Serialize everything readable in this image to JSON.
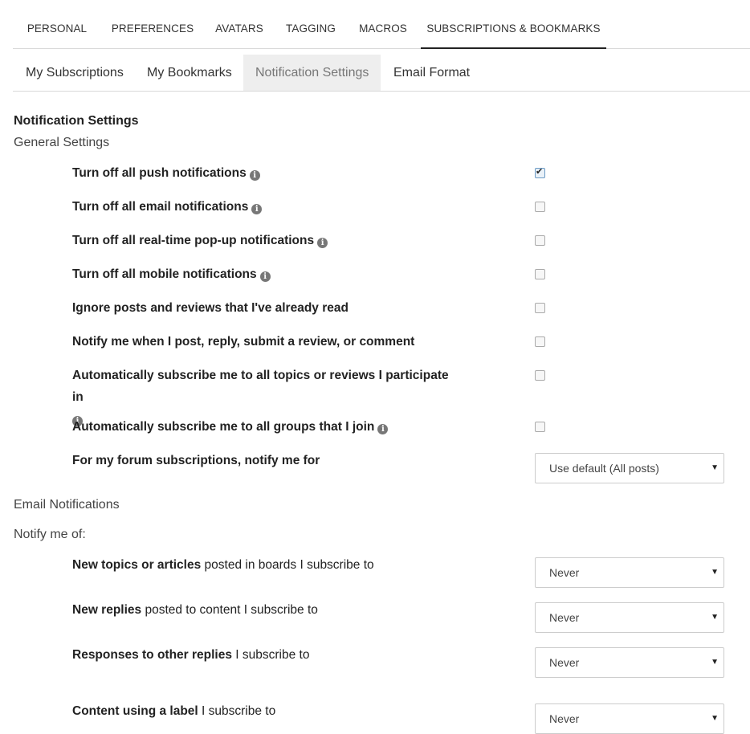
{
  "top_tabs": [
    {
      "label": "PERSONAL"
    },
    {
      "label": "PREFERENCES"
    },
    {
      "label": "AVATARS"
    },
    {
      "label": "TAGGING"
    },
    {
      "label": "MACROS"
    },
    {
      "label": "SUBSCRIPTIONS & BOOKMARKS",
      "active": true
    }
  ],
  "sub_tabs": [
    {
      "label": "My Subscriptions"
    },
    {
      "label": "My Bookmarks"
    },
    {
      "label": "Notification Settings",
      "active": true
    },
    {
      "label": "Email Format"
    }
  ],
  "section_title": "Notification Settings",
  "general_heading": "General Settings",
  "general_settings": [
    {
      "label": "Turn off all push notifications",
      "info": true,
      "checked": true
    },
    {
      "label": "Turn off all email notifications",
      "info": true,
      "checked": false
    },
    {
      "label": "Turn off all real-time pop-up notifications",
      "info": true,
      "checked": false
    },
    {
      "label": "Turn off all mobile notifications",
      "info": true,
      "checked": false
    },
    {
      "label": "Ignore posts and reviews that I've already read",
      "info": false,
      "checked": false
    },
    {
      "label": "Notify me when I post, reply, submit a review, or comment",
      "info": false,
      "checked": false
    },
    {
      "label": "Automatically subscribe me to all topics or reviews I participate in",
      "info": true,
      "checked": false
    },
    {
      "label": "Automatically subscribe me to all groups that I join",
      "info": true,
      "checked": false
    }
  ],
  "forum_subscriptions": {
    "label": "For my forum subscriptions, notify me for",
    "value": "Use default (All posts)"
  },
  "email_heading": "Email Notifications",
  "notify_heading": "Notify me of:",
  "email_rows": [
    {
      "bold": "New topics or articles",
      "rest": " posted in boards I subscribe to",
      "value": "Never"
    },
    {
      "bold": "New replies",
      "rest": " posted to content I subscribe to",
      "value": "Never"
    },
    {
      "bold": "Responses to other replies",
      "rest": " I subscribe to",
      "value": "Never"
    },
    {
      "bold": "Content using a label",
      "rest": " I subscribe to",
      "value": "Never"
    }
  ],
  "icons": {
    "info": "info-icon",
    "caret": "chevron-down-icon",
    "check": "checkmark-icon"
  }
}
